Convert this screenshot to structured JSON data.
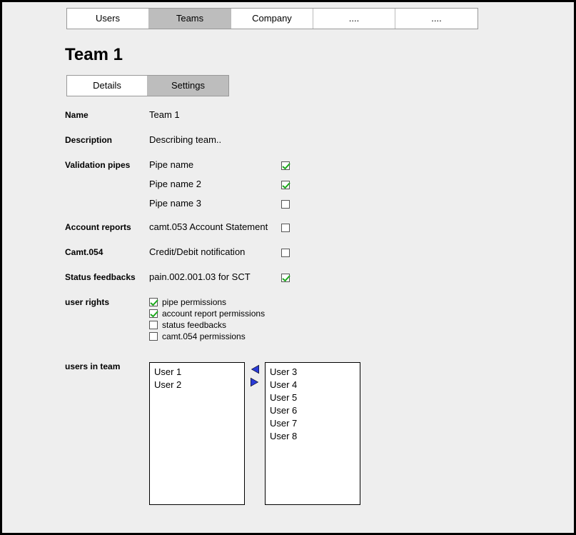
{
  "topnav": {
    "tabs": [
      "Users",
      "Teams",
      "Company",
      "....",
      "...."
    ],
    "active": 1
  },
  "page_title": "Team 1",
  "subnav": {
    "tabs": [
      "Details",
      "Settings"
    ],
    "active": 1
  },
  "fields": {
    "name_label": "Name",
    "name_value": "Team 1",
    "desc_label": "Description",
    "desc_value": "Describing team..",
    "validation_label": "Validation pipes",
    "pipes": [
      {
        "label": "Pipe name",
        "checked": true
      },
      {
        "label": "Pipe name 2",
        "checked": true
      },
      {
        "label": "Pipe name 3",
        "checked": false
      }
    ],
    "account_reports_label": "Account reports",
    "account_reports_value": "camt.053 Account Statement",
    "account_reports_checked": false,
    "camt054_label": "Camt.054",
    "camt054_value": "Credit/Debit notification",
    "camt054_checked": false,
    "status_feedbacks_label": "Status feedbacks",
    "status_feedbacks_value": "pain.002.001.03 for SCT",
    "status_feedbacks_checked": true
  },
  "user_rights": {
    "label": "user rights",
    "items": [
      {
        "label": "pipe permissions",
        "checked": true
      },
      {
        "label": "account report permissions",
        "checked": true
      },
      {
        "label": "status feedbacks",
        "checked": false
      },
      {
        "label": "camt.054 permissions",
        "checked": false
      }
    ]
  },
  "users_in_team": {
    "label": "users in team",
    "left": [
      "User 1",
      "User 2"
    ],
    "right": [
      "User 3",
      "User 4",
      "User 5",
      "User 6",
      "User 7",
      "User 8"
    ]
  }
}
